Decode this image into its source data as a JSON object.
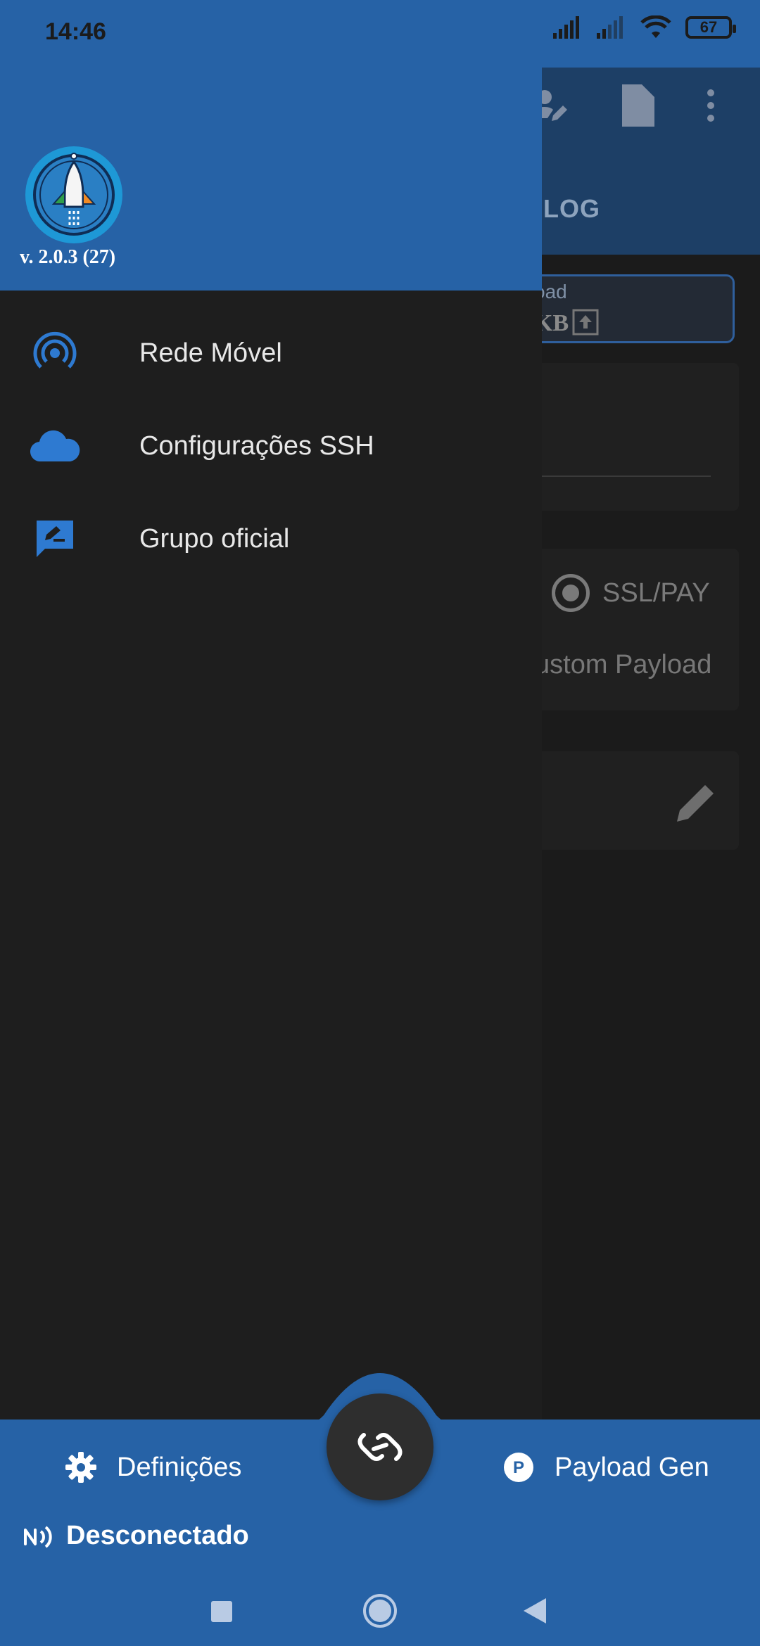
{
  "status_bar": {
    "time": "14:46",
    "battery": "67"
  },
  "background": {
    "tab_log": "LOG",
    "payload_label": "oad",
    "kb_label": "KB",
    "radio_label": "SSL/PAY",
    "custom_label": "ustom Payload"
  },
  "drawer": {
    "version": "v. 2.0.3 (27)",
    "items": [
      {
        "label": "Rede Móvel",
        "icon": "broadcast-icon"
      },
      {
        "label": "Configurações SSH",
        "icon": "cloud-icon"
      },
      {
        "label": "Grupo oficial",
        "icon": "chat-edit-icon"
      }
    ]
  },
  "bottom_nav": {
    "settings_label": "Definições",
    "payload_label": "Payload Gen",
    "connection_status": "Desconectado"
  },
  "colors": {
    "primary": "#2662a6",
    "drawer_bg": "#1e1e1e"
  }
}
